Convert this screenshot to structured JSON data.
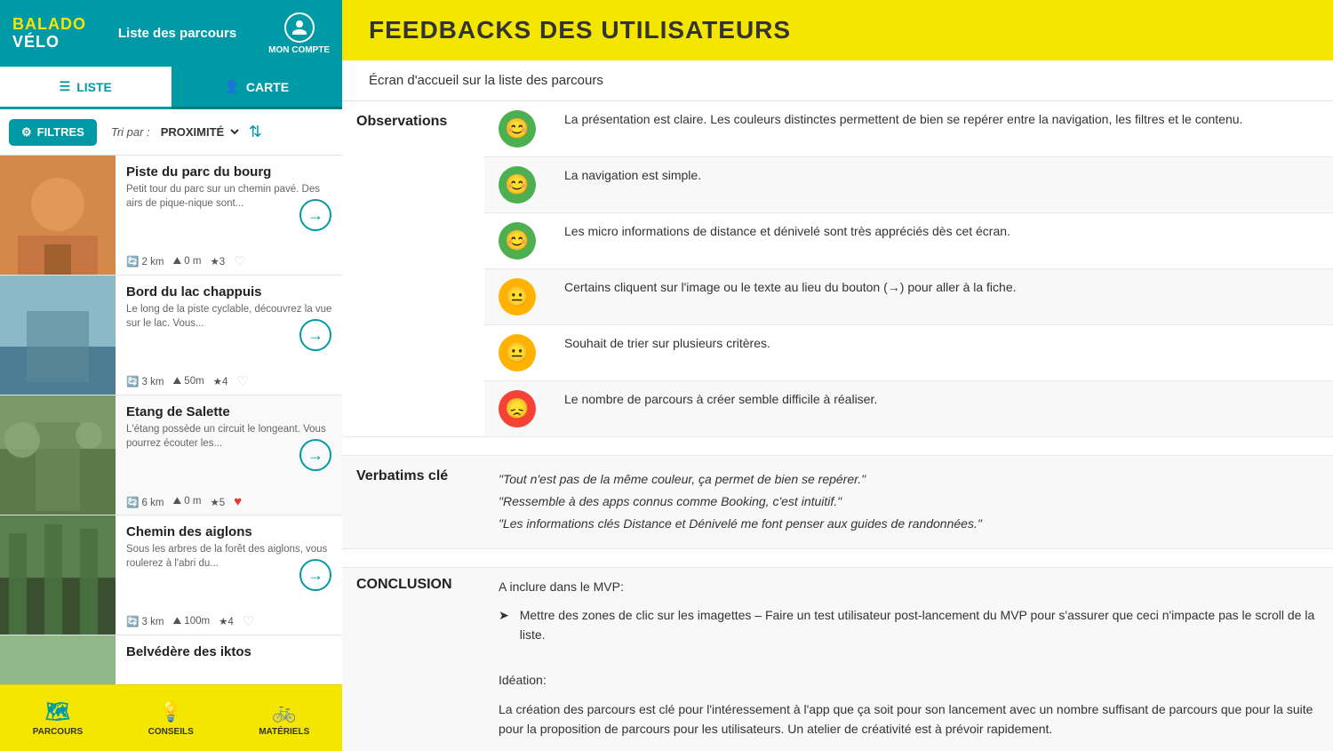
{
  "app": {
    "logo_balado": "BALADO",
    "logo_velo": "VÉLO",
    "header_title": "Liste des parcours",
    "account_label": "MON COMPTE"
  },
  "tabs": {
    "liste_label": "LISTE",
    "carte_label": "CARTE"
  },
  "filters": {
    "filter_btn": "FILTRES",
    "tri_label": "Tri par :",
    "tri_value": "PROXIMITÉ"
  },
  "routes": [
    {
      "title": "Piste du parc du bourg",
      "desc": "Petit tour du parc sur un chemin pavé. Des airs de pique-nique sont...",
      "distance": "2 km",
      "elevation": "0 m",
      "stars": "★3",
      "liked": false,
      "img_class": "img-parc"
    },
    {
      "title": "Bord du lac chappuis",
      "desc": "Le long de la piste cyclable, découvrez la vue sur le lac. Vous...",
      "distance": "3 km",
      "elevation": "50m",
      "stars": "★4",
      "liked": false,
      "img_class": "img-lac"
    },
    {
      "title": "Etang de Salette",
      "desc": "L'étang possède un circuit le longeant. Vous pourrez écouter les...",
      "distance": "6 km",
      "elevation": "0 m",
      "stars": "★5",
      "liked": true,
      "img_class": "img-salette"
    },
    {
      "title": "Chemin des aiglons",
      "desc": "Sous les arbres de la forêt des aiglons, vous roulerez à l'abri du...",
      "distance": "3 km",
      "elevation": "100m",
      "stars": "★4",
      "liked": false,
      "img_class": "img-aiglon"
    },
    {
      "title": "Belvédère des iktos",
      "desc": "",
      "distance": "",
      "elevation": "",
      "stars": "",
      "liked": false,
      "img_class": "img-default"
    }
  ],
  "bottom_nav": [
    {
      "label": "PARCOURS",
      "icon": "🗺",
      "active": true
    },
    {
      "label": "CONSEILS",
      "icon": "💡",
      "active": false
    },
    {
      "label": "MATÉRIELS",
      "icon": "🚲",
      "active": false
    }
  ],
  "feedback": {
    "title": "FEEDBACKS DES UTILISATEURS",
    "screen_label": "Écran d'accueil sur la liste des parcours",
    "observations_label": "Observations",
    "observations": [
      {
        "sentiment": "green",
        "emoji": "😊",
        "text": "La présentation est claire. Les couleurs distinctes permettent de bien se repérer entre la navigation, les filtres et le contenu."
      },
      {
        "sentiment": "green",
        "emoji": "😊",
        "text": "La navigation est simple."
      },
      {
        "sentiment": "green",
        "emoji": "😊",
        "text": "Les micro informations de distance et dénivelé sont très appréciés dès cet écran."
      },
      {
        "sentiment": "yellow",
        "emoji": "😐",
        "text": "Certains cliquent sur l'image ou le texte au lieu du bouton (→) pour aller à la fiche."
      },
      {
        "sentiment": "yellow",
        "emoji": "😐",
        "text": "Souhait de trier sur plusieurs critères."
      },
      {
        "sentiment": "red",
        "emoji": "😞",
        "text": "Le nombre de parcours à créer semble difficile à réaliser."
      }
    ],
    "verbatims_label": "Verbatims clé",
    "verbatims": [
      "\"Tout n'est pas de la même couleur, ça permet de bien se repérer.\"",
      "\"Ressemble à des apps connus comme Booking, c'est intuitif.\"",
      "\"Les informations clés Distance et Dénivelé me font penser aux guides de randonnées.\""
    ],
    "conclusion_label": "CONCLUSION",
    "conclusion_mvp_title": "A inclure dans le MVP:",
    "conclusion_mvp_item": "Mettre des zones de clic sur les imagettes – Faire un test utilisateur post-lancement du MVP pour s'assurer que ceci n'impacte pas le scroll de la liste.",
    "conclusion_ideation_title": "Idéation:",
    "conclusion_ideation_text": "La création des parcours est clé pour l'intéressement à l'app que ça soit pour son lancement avec un nombre suffisant de parcours que pour la suite pour la proposition de parcours pour les utilisateurs. Un atelier de créativité est à prévoir rapidement."
  }
}
